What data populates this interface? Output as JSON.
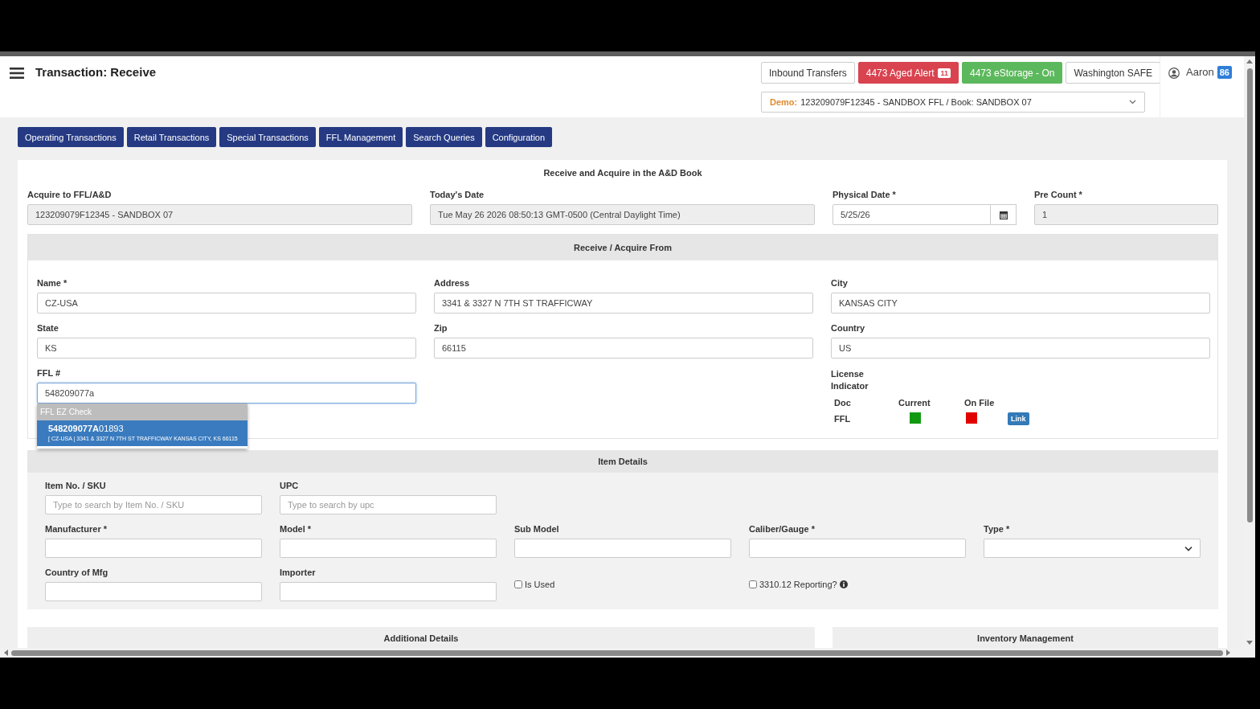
{
  "header": {
    "title": "Transaction: Receive",
    "buttons": [
      {
        "label": "Inbound Transfers",
        "kind": "default"
      },
      {
        "label": "4473 Aged Alert",
        "kind": "danger",
        "badge": "11"
      },
      {
        "label": "4473 eStorage - On",
        "kind": "success"
      },
      {
        "label": "Washington SAFE",
        "kind": "default"
      }
    ],
    "book_select": {
      "prefix": "Demo:",
      "value": "123209079F12345 - SANDBOX FFL / Book: SANDBOX 07"
    },
    "user": {
      "name": "Aaron",
      "badge": "86"
    }
  },
  "nav_tabs": [
    {
      "label": "Operating Transactions"
    },
    {
      "label": "Retail Transactions"
    },
    {
      "label": "Special Transactions"
    },
    {
      "label": "FFL Management"
    },
    {
      "label": "Search Queries"
    },
    {
      "label": "Configuration"
    }
  ],
  "form": {
    "title": "Receive and Acquire in the A&D Book",
    "top_fields": [
      {
        "label": "Acquire to FFL/A&D",
        "value": "123209079F12345 - SANDBOX 07",
        "kind": "readonly"
      },
      {
        "label": "Today's Date",
        "value": "Tue May 26 2026 08:50:13 GMT-0500 (Central Daylight Time)",
        "kind": "readonly"
      },
      {
        "label": "Physical Date *",
        "value": "5/25/26",
        "kind": "date"
      },
      {
        "label": "Pre Count *",
        "value": "1",
        "kind": "readonly"
      }
    ],
    "acquire_from": {
      "title": "Receive / Acquire From",
      "fields": [
        {
          "label": "Name *",
          "value": "CZ-USA"
        },
        {
          "label": "Address",
          "value": "3341 & 3327 N 7TH ST TRAFFICWAY"
        },
        {
          "label": "City",
          "value": "KANSAS CITY"
        },
        {
          "label": "State",
          "value": "KS"
        },
        {
          "label": "Zip",
          "value": "66115"
        },
        {
          "label": "Country",
          "value": "US"
        }
      ],
      "ffl": {
        "label": "FFL #",
        "value": "548209077a"
      },
      "suggestions": {
        "header": "FFL EZ Check",
        "items": [
          {
            "title": "**548209077A**01893",
            "detail": "[ CZ-USA | 3341 & 3327 N 7TH ST TRAFFICWAY KANSAS CITY, KS 66115",
            "selected": true
          }
        ]
      },
      "license_indicator": {
        "title": "License Indicator",
        "columns": [
          "Doc",
          "Current",
          "On File"
        ],
        "rows": [
          {
            "doc": "FFL",
            "indicators": [
              {
                "color": "#119a11"
              },
              {
                "color": "#e00000"
              }
            ],
            "link": "Link"
          }
        ]
      }
    },
    "item_details": {
      "title": "Item Details",
      "rows": [
        [
          {
            "kind": "text",
            "label": "Item No. / SKU",
            "placeholder": "Type to search by Item No. / SKU"
          },
          {
            "kind": "text",
            "label": "UPC",
            "placeholder": "Type to search by upc"
          }
        ],
        [
          {
            "kind": "text",
            "label": "Manufacturer *"
          },
          {
            "kind": "text",
            "label": "Model *"
          },
          {
            "kind": "text",
            "label": "Sub Model"
          },
          {
            "kind": "text",
            "label": "Caliber/Gauge *"
          },
          {
            "kind": "select",
            "label": "Type *"
          }
        ],
        [
          {
            "kind": "text",
            "label": "Country of Mfg"
          },
          {
            "kind": "text",
            "label": "Importer"
          },
          {
            "kind": "checkbox",
            "label": "Is Used",
            "checked": false,
            "info": false
          },
          {
            "kind": "checkbox",
            "label": "3310.12 Reporting?",
            "checked": false,
            "info": true
          }
        ]
      ]
    },
    "bottom_panels": [
      {
        "title": "Additional Details"
      },
      {
        "title": "Inventory Management"
      }
    ]
  }
}
